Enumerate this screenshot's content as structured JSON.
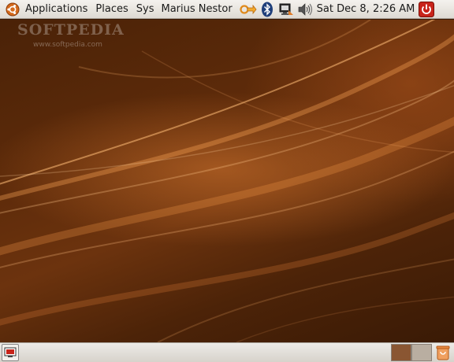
{
  "top_panel": {
    "menus": [
      {
        "label": "Applications"
      },
      {
        "label": "Places"
      },
      {
        "label": "Sys"
      }
    ],
    "user_name": "Marius Nestor",
    "clock": "Sat Dec  8,  2:26 AM",
    "tray_icons": [
      "network-switcher-icon",
      "bluetooth-icon",
      "network-monitor-icon",
      "volume-icon"
    ]
  },
  "desktop": {
    "watermark_title": "SOFTPEDIA",
    "watermark_url": "www.softpedia.com"
  },
  "bottom_panel": {
    "workspaces": [
      {
        "color": "#8a5632",
        "active": true
      },
      {
        "color": "#b9aea1",
        "active": false
      }
    ]
  },
  "colors": {
    "panel": "#e6e2dc",
    "accent_orange": "#e07b27",
    "desktop_brown": "#5e2b0a"
  }
}
